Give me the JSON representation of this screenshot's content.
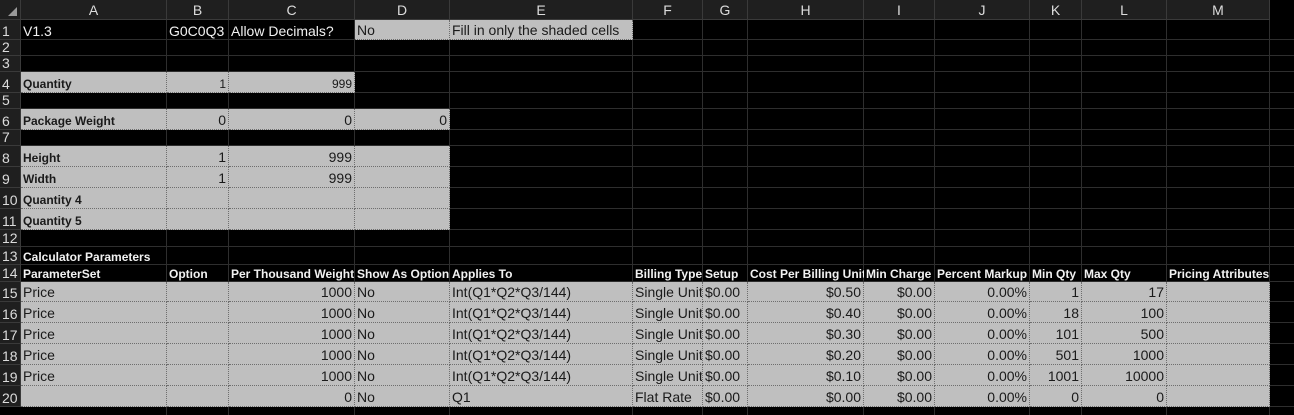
{
  "columns": [
    "A",
    "B",
    "C",
    "D",
    "E",
    "F",
    "G",
    "H",
    "I",
    "J",
    "K",
    "L",
    "M"
  ],
  "rows": [
    "1",
    "2",
    "3",
    "4",
    "5",
    "6",
    "7",
    "8",
    "9",
    "10",
    "11",
    "12",
    "13",
    "14",
    "15",
    "16",
    "17",
    "18",
    "19",
    "20"
  ],
  "r1": {
    "a": "V1.3",
    "b": "G0C0Q3",
    "c": "Allow Decimals?",
    "d": "No",
    "e": "Fill in only the shaded cells"
  },
  "r4": {
    "a": "Quantity",
    "b": "1",
    "c": "999"
  },
  "r6": {
    "a": "Package Weight",
    "b": "0",
    "c": "0",
    "d": "0"
  },
  "r8": {
    "a": "Height",
    "b": "1",
    "c": "999"
  },
  "r9": {
    "a": "Width",
    "b": "1",
    "c": "999"
  },
  "r10": {
    "a": "Quantity 4"
  },
  "r11": {
    "a": "Quantity 5"
  },
  "r13": {
    "a": "Calculator Parameters"
  },
  "headers": {
    "a": "ParameterSet",
    "b": "Option",
    "c": "Per Thousand Weight",
    "d": "Show As Option",
    "e": "Applies To",
    "f": "Billing Type",
    "g": "Setup",
    "h": "Cost Per Billing Unit",
    "i": "Min Charge",
    "j": "Percent Markup",
    "k": "Min Qty",
    "l": "Max Qty",
    "m": "Pricing Attributes"
  },
  "table": [
    {
      "a": "Price",
      "b": "",
      "c": "1000",
      "d": "No",
      "e": "Int(Q1*Q2*Q3/144)",
      "f": "Single Unit",
      "g": "$0.00",
      "h": "$0.50",
      "i": "$0.00",
      "j": "0.00%",
      "k": "1",
      "l": "17",
      "m": ""
    },
    {
      "a": "Price",
      "b": "",
      "c": "1000",
      "d": "No",
      "e": "Int(Q1*Q2*Q3/144)",
      "f": "Single Unit",
      "g": "$0.00",
      "h": "$0.40",
      "i": "$0.00",
      "j": "0.00%",
      "k": "18",
      "l": "100",
      "m": ""
    },
    {
      "a": "Price",
      "b": "",
      "c": "1000",
      "d": "No",
      "e": "Int(Q1*Q2*Q3/144)",
      "f": "Single Unit",
      "g": "$0.00",
      "h": "$0.30",
      "i": "$0.00",
      "j": "0.00%",
      "k": "101",
      "l": "500",
      "m": ""
    },
    {
      "a": "Price",
      "b": "",
      "c": "1000",
      "d": "No",
      "e": "Int(Q1*Q2*Q3/144)",
      "f": "Single Unit",
      "g": "$0.00",
      "h": "$0.20",
      "i": "$0.00",
      "j": "0.00%",
      "k": "501",
      "l": "1000",
      "m": ""
    },
    {
      "a": "Price",
      "b": "",
      "c": "1000",
      "d": "No",
      "e": "Int(Q1*Q2*Q3/144)",
      "f": "Single Unit",
      "g": "$0.00",
      "h": "$0.10",
      "i": "$0.00",
      "j": "0.00%",
      "k": "1001",
      "l": "10000",
      "m": ""
    },
    {
      "a": "",
      "b": "",
      "c": "0",
      "d": "No",
      "e": "Q1",
      "f": "Flat Rate",
      "g": "$0.00",
      "h": "$0.00",
      "i": "$0.00",
      "j": "0.00%",
      "k": "0",
      "l": "0",
      "m": ""
    }
  ]
}
